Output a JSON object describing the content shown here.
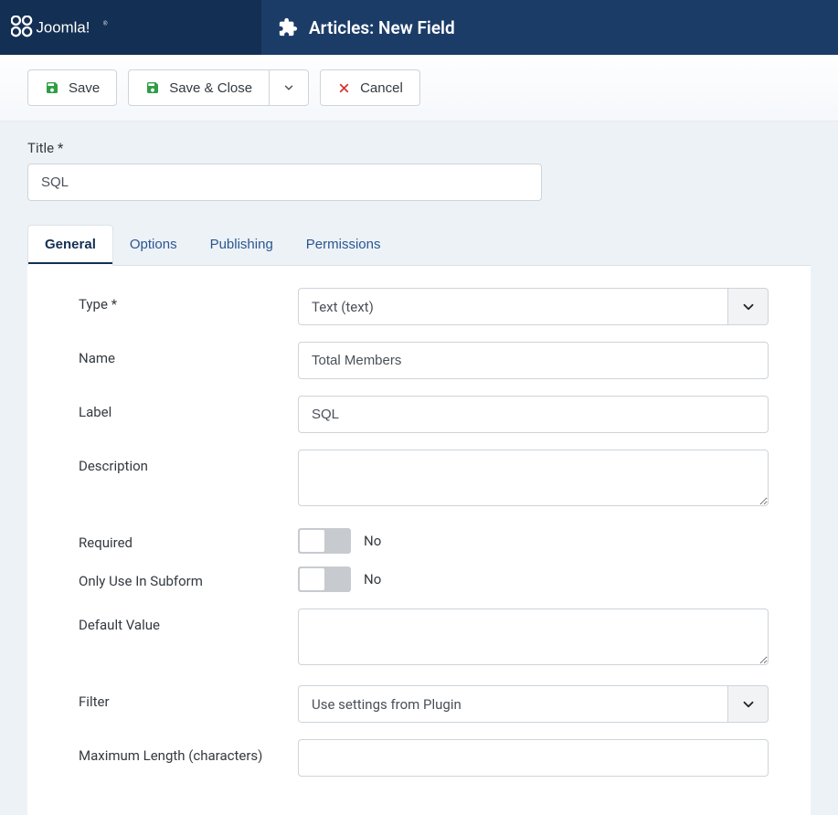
{
  "brand": {
    "name": "Joomla!"
  },
  "header": {
    "title": "Articles: New Field"
  },
  "toolbar": {
    "save_label": "Save",
    "save_close_label": "Save & Close",
    "cancel_label": "Cancel"
  },
  "title_field": {
    "label": "Title *",
    "value": "SQL"
  },
  "tabs": [
    {
      "label": "General",
      "active": true
    },
    {
      "label": "Options",
      "active": false
    },
    {
      "label": "Publishing",
      "active": false
    },
    {
      "label": "Permissions",
      "active": false
    }
  ],
  "form": {
    "type": {
      "label": "Type *",
      "value": "Text (text)"
    },
    "name": {
      "label": "Name",
      "value": "Total Members"
    },
    "labelField": {
      "label": "Label",
      "value": "SQL"
    },
    "description": {
      "label": "Description",
      "value": ""
    },
    "required": {
      "label": "Required",
      "state": "No"
    },
    "only_subform": {
      "label": "Only Use In Subform",
      "state": "No"
    },
    "default_value": {
      "label": "Default Value",
      "value": ""
    },
    "filter": {
      "label": "Filter",
      "value": "Use settings from Plugin"
    },
    "max_length": {
      "label": "Maximum Length (characters)",
      "value": ""
    }
  }
}
